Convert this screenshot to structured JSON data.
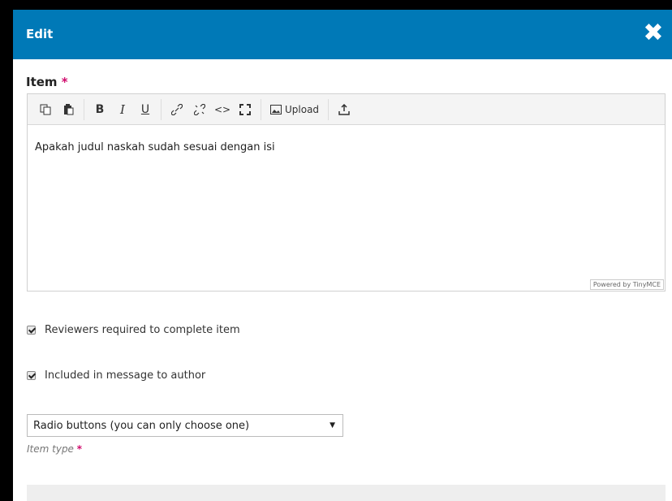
{
  "dialog": {
    "title": "Edit",
    "close_icon": "close-x-icon"
  },
  "item_field": {
    "label": "Item",
    "required_mark": "*",
    "content": "Apakah judul naskah sudah sesuai dengan isi",
    "powered_by": "Powered by TinyMCE"
  },
  "toolbar": {
    "buttons": [
      "copy-icon",
      "paste-icon",
      "bold-icon",
      "italic-icon",
      "underline-icon",
      "link-icon",
      "unlink-icon",
      "code-icon",
      "fullscreen-icon",
      "image-upload-icon",
      "upload-icon"
    ],
    "bold_label": "B",
    "italic_label": "I",
    "underline_label": "U",
    "code_label": "<>",
    "upload_label": "Upload"
  },
  "checkboxes": {
    "reviewers_required": {
      "label": "Reviewers required to complete item",
      "checked": true
    },
    "included_message": {
      "label": "Included in message to author",
      "checked": true
    }
  },
  "item_type": {
    "selected": "Radio buttons (you can only choose one)",
    "help_label": "Item type",
    "required_mark": "*"
  }
}
